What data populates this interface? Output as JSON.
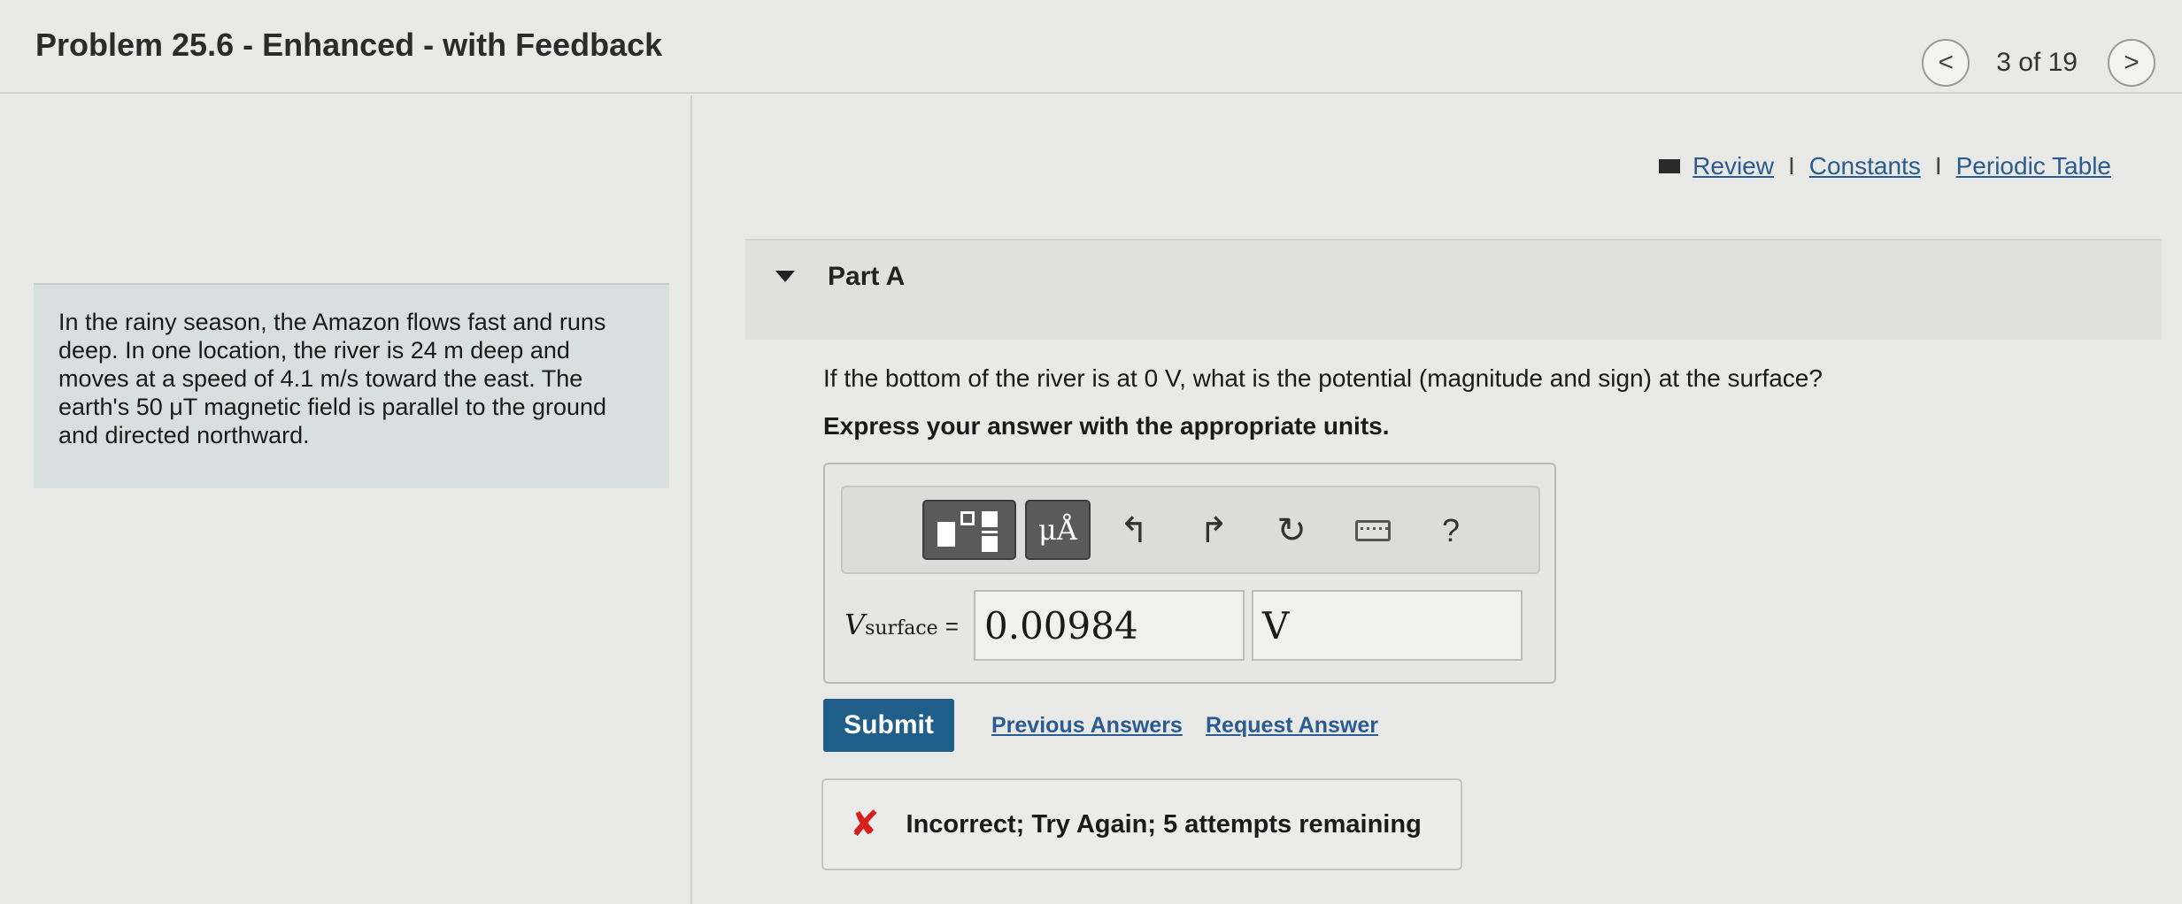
{
  "header": {
    "title": "Problem 25.6 - Enhanced - with Feedback",
    "prev_glyph": "<",
    "next_glyph": ">",
    "pager_text": "3 of 19"
  },
  "links": {
    "review": "Review",
    "constants": "Constants",
    "periodic_table": "Periodic Table",
    "separator": "I"
  },
  "problem": {
    "text": "In the rainy season, the Amazon flows fast and runs deep. In one location, the river is 24 m deep and moves at a speed of 4.1 m/s toward the east. The earth's 50 μT magnetic field is parallel to the ground and directed northward."
  },
  "part": {
    "label": "Part A",
    "question": "If the bottom of the river is at 0 V, what is the potential (magnitude and sign) at the surface?",
    "instruction": "Express your answer with the appropriate units."
  },
  "toolbar": {
    "units_label": "μÅ",
    "undo_glyph": "↰",
    "redo_glyph": "↱",
    "reset_glyph": "↻",
    "help_label": "?"
  },
  "answer": {
    "variable": "V",
    "subscript": "surface",
    "equals": "=",
    "value": "0.00984",
    "unit": "V"
  },
  "actions": {
    "submit": "Submit",
    "previous_answers": "Previous Answers",
    "request_answer": "Request Answer"
  },
  "feedback": {
    "icon": "✘",
    "message": "Incorrect; Try Again; 5 attempts remaining"
  },
  "colors": {
    "submit_bg": "#1f5f89",
    "link": "#2a5c92",
    "error": "#d62020",
    "problem_bg": "#d7e0de"
  }
}
